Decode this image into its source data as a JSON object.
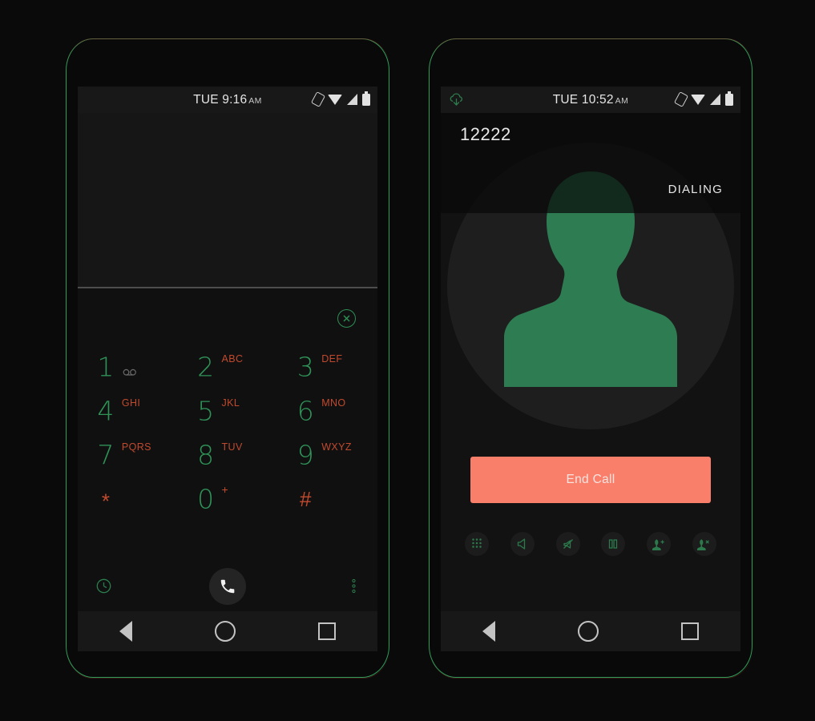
{
  "meta": {
    "accent_green": "#2e9e5b",
    "accent_orange": "#c04a2e",
    "endcall_red": "#fa7f6b",
    "screen_bg": "#121212"
  },
  "left_phone": {
    "name": "dialer-phone",
    "status_bar": {
      "clock_day": "TUE",
      "clock_time": "9:16",
      "clock_ampm": "AM",
      "icons": [
        "rotation-lock-icon",
        "wifi-icon",
        "signal-icon",
        "battery-icon"
      ]
    },
    "display": {
      "number": "",
      "placeholder": ""
    },
    "clear_button": {
      "icon": "close-circle-icon",
      "label": ""
    },
    "keypad": [
      [
        {
          "digit": "1",
          "letters": "",
          "sub_icon": "voicemail-icon"
        },
        {
          "digit": "2",
          "letters": "ABC",
          "sub_icon": ""
        },
        {
          "digit": "3",
          "letters": "DEF",
          "sub_icon": ""
        }
      ],
      [
        {
          "digit": "4",
          "letters": "GHI",
          "sub_icon": ""
        },
        {
          "digit": "5",
          "letters": "JKL",
          "sub_icon": ""
        },
        {
          "digit": "6",
          "letters": "MNO",
          "sub_icon": ""
        }
      ],
      [
        {
          "digit": "7",
          "letters": "PQRS",
          "sub_icon": ""
        },
        {
          "digit": "8",
          "letters": "TUV",
          "sub_icon": ""
        },
        {
          "digit": "9",
          "letters": "WXYZ",
          "sub_icon": ""
        }
      ],
      [
        {
          "digit": "*",
          "letters": "",
          "sub_icon": ""
        },
        {
          "digit": "0",
          "letters": "+",
          "sub_icon": ""
        },
        {
          "digit": "#",
          "letters": "",
          "sub_icon": ""
        }
      ]
    ],
    "toolbar": {
      "history_icon": "clock-history-icon",
      "call_icon": "phone-handset-icon",
      "overflow_icon": "more-vertical-icon"
    },
    "nav_bar": {
      "back": "back-triangle-icon",
      "home": "home-circle-icon",
      "recents": "recents-square-icon"
    }
  },
  "right_phone": {
    "name": "in-call-phone",
    "status_bar": {
      "left_icon": "cloud-download-icon",
      "clock_day": "TUE",
      "clock_time": "10:52",
      "clock_ampm": "AM",
      "icons": [
        "rotation-lock-icon",
        "wifi-icon",
        "signal-icon",
        "battery-icon"
      ]
    },
    "call": {
      "number": "12222",
      "status": "DIALING",
      "avatar_icon": "contact-silhouette-icon",
      "end_call_label": "End Call"
    },
    "controls": [
      {
        "name": "dialpad-icon",
        "label": "Dialpad"
      },
      {
        "name": "speaker-icon",
        "label": "Speaker"
      },
      {
        "name": "mute-icon",
        "label": "Mute"
      },
      {
        "name": "hold-pause-icon",
        "label": "Hold"
      },
      {
        "name": "add-call-icon",
        "label": "Add call"
      },
      {
        "name": "remove-call-icon",
        "label": "Remove"
      }
    ],
    "nav_bar": {
      "back": "back-triangle-icon",
      "home": "home-circle-icon",
      "recents": "recents-square-icon"
    }
  }
}
